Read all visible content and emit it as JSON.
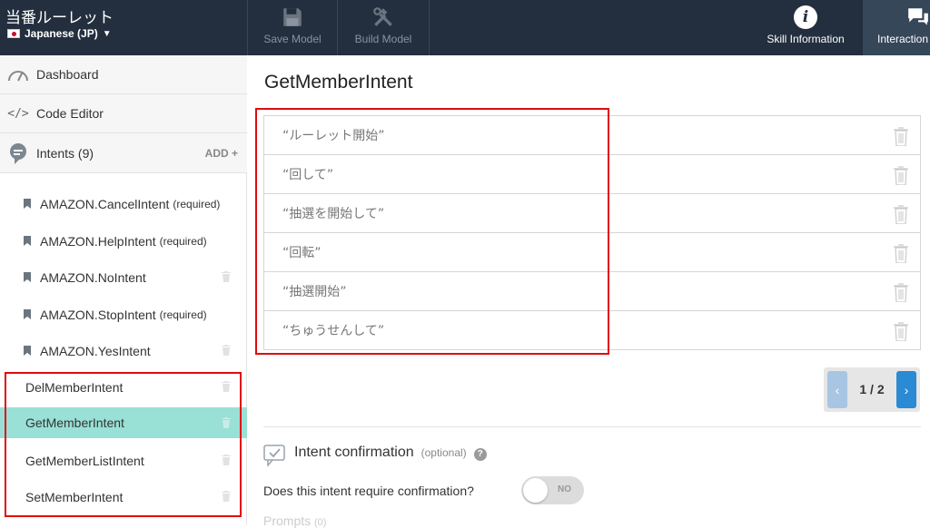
{
  "header": {
    "app_title": "当番ルーレット",
    "locale": "Japanese (JP)",
    "locale_arrow": "▼",
    "save_model": "Save Model",
    "build_model": "Build Model",
    "skill_information": "Skill Information",
    "interaction": "Interaction"
  },
  "sidebar": {
    "dashboard": "Dashboard",
    "code_editor": "Code Editor",
    "intents": "Intents (9)",
    "add": "ADD +",
    "items": [
      {
        "label": "AMAZON.CancelIntent",
        "tag": "(required)"
      },
      {
        "label": "AMAZON.HelpIntent",
        "tag": "(required)"
      },
      {
        "label": "AMAZON.NoIntent",
        "tag": ""
      },
      {
        "label": "AMAZON.StopIntent",
        "tag": "(required)"
      },
      {
        "label": "AMAZON.YesIntent",
        "tag": ""
      },
      {
        "label": "DelMemberIntent",
        "tag": ""
      },
      {
        "label": "GetMemberIntent",
        "tag": ""
      },
      {
        "label": "GetMemberListIntent",
        "tag": ""
      },
      {
        "label": "SetMemberIntent",
        "tag": ""
      }
    ]
  },
  "main": {
    "title": "GetMemberIntent",
    "utterances": [
      "“ルーレット開始”",
      "“回して”",
      "“抽選を開始して”",
      "“回転”",
      "“抽選開始”",
      "“ちゅうせんして”"
    ],
    "pager": "1 / 2",
    "confirmation_title": "Intent confirmation",
    "confirmation_optional": "(optional)",
    "confirmation_help": "?",
    "confirmation_question": "Does this intent require confirmation?",
    "toggle_label": "NO",
    "prompts": "Prompts",
    "prompts_count": "(0)"
  },
  "colors": {
    "topbar": "#232f3e",
    "active_intent": "#99e0d6",
    "highlight_box": "#e10b0b",
    "pager_next": "#2a8ad4"
  }
}
